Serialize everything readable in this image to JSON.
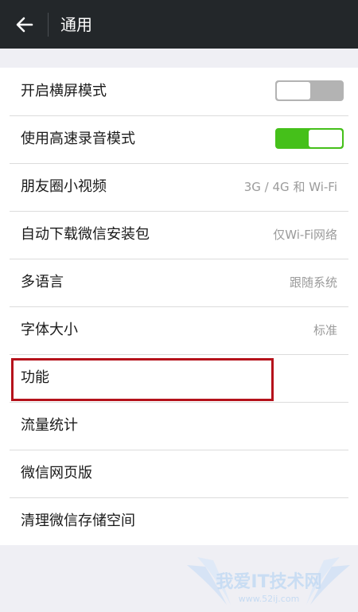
{
  "header": {
    "title": "通用",
    "back_icon": "arrow-left-icon"
  },
  "settings": [
    {
      "label": "开启横屏模式",
      "type": "toggle",
      "state": "off"
    },
    {
      "label": "使用高速录音模式",
      "type": "toggle",
      "state": "on"
    },
    {
      "label": "朋友圈小视频",
      "type": "value",
      "value": "3G / 4G 和 Wi-Fi"
    },
    {
      "label": "自动下载微信安装包",
      "type": "value",
      "value": "仅Wi-Fi网络"
    },
    {
      "label": "多语言",
      "type": "value",
      "value": "跟随系统"
    },
    {
      "label": "字体大小",
      "type": "value",
      "value": "标准"
    },
    {
      "label": "功能",
      "type": "link"
    },
    {
      "label": "流量统计",
      "type": "link"
    },
    {
      "label": "微信网页版",
      "type": "link"
    },
    {
      "label": "清理微信存储空间",
      "type": "link"
    }
  ],
  "annotation": {
    "highlighted_item": "功能",
    "color": "#b5121b"
  },
  "colors": {
    "header_bg": "#23272a",
    "toggle_on": "#45c01a",
    "toggle_off": "#b3b3b3",
    "page_bg": "#efeff4"
  },
  "watermark": {
    "text": "我爱IT技术网",
    "url": "www.52ij.com"
  }
}
